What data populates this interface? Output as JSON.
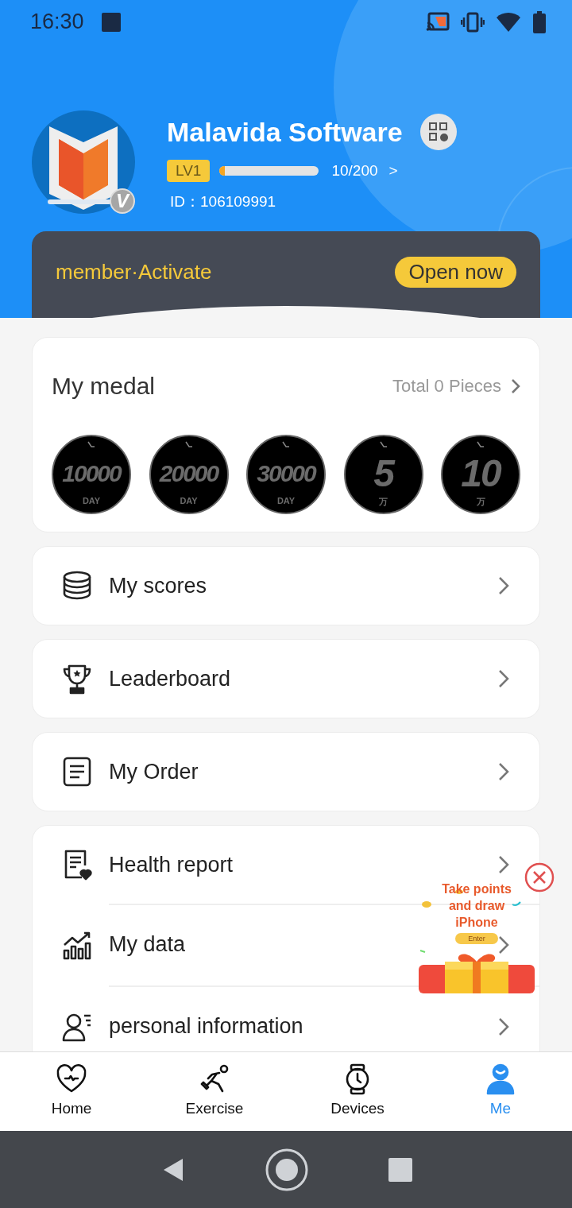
{
  "status_bar": {
    "time": "16:30"
  },
  "profile": {
    "name": "Malavida Software",
    "level_label": "LV1",
    "level": 0.05,
    "progress_text": "10/200",
    "progress_arrow": ">",
    "id_text": "ID：106109991",
    "verified_mark": "V"
  },
  "member_banner": {
    "text": "member·Activate",
    "button": "Open now"
  },
  "medals": {
    "title": "My medal",
    "total": "Total 0 Pieces",
    "items": [
      {
        "value": "10000",
        "unit": "DAY"
      },
      {
        "value": "20000",
        "unit": "DAY"
      },
      {
        "value": "30000",
        "unit": "DAY"
      },
      {
        "value": "5",
        "unit": "万"
      },
      {
        "value": "10",
        "unit": "万"
      }
    ]
  },
  "menu_groups": [
    [
      {
        "label": "My scores"
      }
    ],
    [
      {
        "label": "Leaderboard"
      }
    ],
    [
      {
        "label": "My Order"
      }
    ],
    [
      {
        "label": "Health report"
      },
      {
        "label": "My data"
      },
      {
        "label": "personal information"
      }
    ]
  ],
  "promo": {
    "text": "Take points and draw iPhone",
    "button": "Enter"
  },
  "bottom_nav": [
    {
      "label": "Home",
      "selected": false
    },
    {
      "label": "Exercise",
      "selected": false
    },
    {
      "label": "Devices",
      "selected": false
    },
    {
      "label": "Me",
      "selected": true
    }
  ]
}
